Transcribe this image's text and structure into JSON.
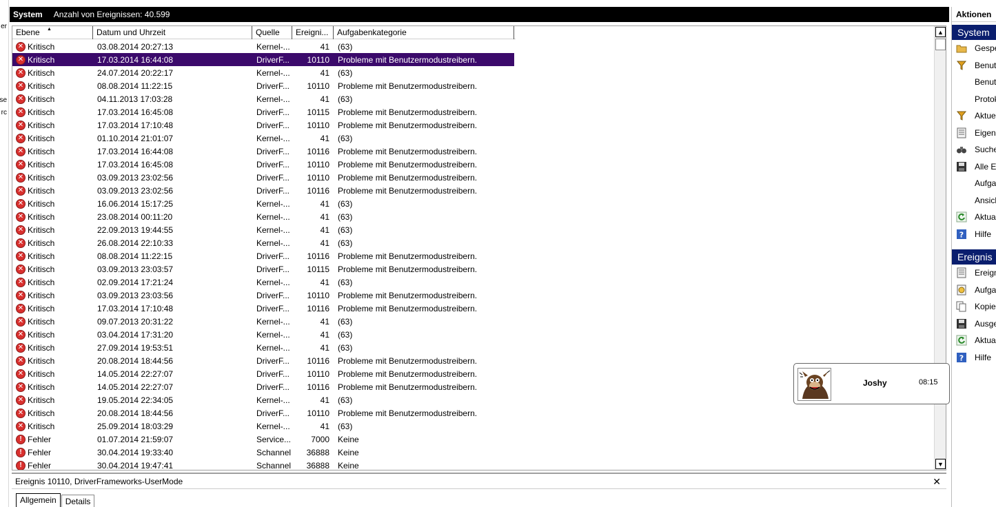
{
  "left_sliver": [
    "er",
    "se",
    "rc"
  ],
  "header": {
    "title": "System",
    "count_text": "Anzahl von Ereignissen: 40.599"
  },
  "columns": [
    "Ebene",
    "Datum und Uhrzeit",
    "Quelle",
    "Ereigni...",
    "Aufgabenkategorie"
  ],
  "rows": [
    {
      "level": "Kritisch",
      "type": "critical",
      "date": "03.08.2014 20:27:13",
      "source": "Kernel-...",
      "id": "41",
      "category": "(63)"
    },
    {
      "level": "Kritisch",
      "type": "critical",
      "date": "17.03.2014 16:44:08",
      "source": "DriverF...",
      "id": "10110",
      "category": "Probleme mit Benutzermodustreibern.",
      "selected": true
    },
    {
      "level": "Kritisch",
      "type": "critical",
      "date": "24.07.2014 20:22:17",
      "source": "Kernel-...",
      "id": "41",
      "category": "(63)"
    },
    {
      "level": "Kritisch",
      "type": "critical",
      "date": "08.08.2014 11:22:15",
      "source": "DriverF...",
      "id": "10110",
      "category": "Probleme mit Benutzermodustreibern."
    },
    {
      "level": "Kritisch",
      "type": "critical",
      "date": "04.11.2013 17:03:28",
      "source": "Kernel-...",
      "id": "41",
      "category": "(63)"
    },
    {
      "level": "Kritisch",
      "type": "critical",
      "date": "17.03.2014 16:45:08",
      "source": "DriverF...",
      "id": "10115",
      "category": "Probleme mit Benutzermodustreibern."
    },
    {
      "level": "Kritisch",
      "type": "critical",
      "date": "17.03.2014 17:10:48",
      "source": "DriverF...",
      "id": "10110",
      "category": "Probleme mit Benutzermodustreibern."
    },
    {
      "level": "Kritisch",
      "type": "critical",
      "date": "01.10.2014 21:01:07",
      "source": "Kernel-...",
      "id": "41",
      "category": "(63)"
    },
    {
      "level": "Kritisch",
      "type": "critical",
      "date": "17.03.2014 16:44:08",
      "source": "DriverF...",
      "id": "10116",
      "category": "Probleme mit Benutzermodustreibern."
    },
    {
      "level": "Kritisch",
      "type": "critical",
      "date": "17.03.2014 16:45:08",
      "source": "DriverF...",
      "id": "10110",
      "category": "Probleme mit Benutzermodustreibern."
    },
    {
      "level": "Kritisch",
      "type": "critical",
      "date": "03.09.2013 23:02:56",
      "source": "DriverF...",
      "id": "10110",
      "category": "Probleme mit Benutzermodustreibern."
    },
    {
      "level": "Kritisch",
      "type": "critical",
      "date": "03.09.2013 23:02:56",
      "source": "DriverF...",
      "id": "10116",
      "category": "Probleme mit Benutzermodustreibern."
    },
    {
      "level": "Kritisch",
      "type": "critical",
      "date": "16.06.2014 15:17:25",
      "source": "Kernel-...",
      "id": "41",
      "category": "(63)"
    },
    {
      "level": "Kritisch",
      "type": "critical",
      "date": "23.08.2014 00:11:20",
      "source": "Kernel-...",
      "id": "41",
      "category": "(63)"
    },
    {
      "level": "Kritisch",
      "type": "critical",
      "date": "22.09.2013 19:44:55",
      "source": "Kernel-...",
      "id": "41",
      "category": "(63)"
    },
    {
      "level": "Kritisch",
      "type": "critical",
      "date": "26.08.2014 22:10:33",
      "source": "Kernel-...",
      "id": "41",
      "category": "(63)"
    },
    {
      "level": "Kritisch",
      "type": "critical",
      "date": "08.08.2014 11:22:15",
      "source": "DriverF...",
      "id": "10116",
      "category": "Probleme mit Benutzermodustreibern."
    },
    {
      "level": "Kritisch",
      "type": "critical",
      "date": "03.09.2013 23:03:57",
      "source": "DriverF...",
      "id": "10115",
      "category": "Probleme mit Benutzermodustreibern."
    },
    {
      "level": "Kritisch",
      "type": "critical",
      "date": "02.09.2014 17:21:24",
      "source": "Kernel-...",
      "id": "41",
      "category": "(63)"
    },
    {
      "level": "Kritisch",
      "type": "critical",
      "date": "03.09.2013 23:03:56",
      "source": "DriverF...",
      "id": "10110",
      "category": "Probleme mit Benutzermodustreibern."
    },
    {
      "level": "Kritisch",
      "type": "critical",
      "date": "17.03.2014 17:10:48",
      "source": "DriverF...",
      "id": "10116",
      "category": "Probleme mit Benutzermodustreibern."
    },
    {
      "level": "Kritisch",
      "type": "critical",
      "date": "09.07.2013 20:31:22",
      "source": "Kernel-...",
      "id": "41",
      "category": "(63)"
    },
    {
      "level": "Kritisch",
      "type": "critical",
      "date": "03.04.2014 17:31:20",
      "source": "Kernel-...",
      "id": "41",
      "category": "(63)"
    },
    {
      "level": "Kritisch",
      "type": "critical",
      "date": "27.09.2014 19:53:51",
      "source": "Kernel-...",
      "id": "41",
      "category": "(63)"
    },
    {
      "level": "Kritisch",
      "type": "critical",
      "date": "20.08.2014 18:44:56",
      "source": "DriverF...",
      "id": "10116",
      "category": "Probleme mit Benutzermodustreibern."
    },
    {
      "level": "Kritisch",
      "type": "critical",
      "date": "14.05.2014 22:27:07",
      "source": "DriverF...",
      "id": "10110",
      "category": "Probleme mit Benutzermodustreibern."
    },
    {
      "level": "Kritisch",
      "type": "critical",
      "date": "14.05.2014 22:27:07",
      "source": "DriverF...",
      "id": "10116",
      "category": "Probleme mit Benutzermodustreibern."
    },
    {
      "level": "Kritisch",
      "type": "critical",
      "date": "19.05.2014 22:34:05",
      "source": "Kernel-...",
      "id": "41",
      "category": "(63)"
    },
    {
      "level": "Kritisch",
      "type": "critical",
      "date": "20.08.2014 18:44:56",
      "source": "DriverF...",
      "id": "10110",
      "category": "Probleme mit Benutzermodustreibern."
    },
    {
      "level": "Kritisch",
      "type": "critical",
      "date": "25.09.2014 18:03:29",
      "source": "Kernel-...",
      "id": "41",
      "category": "(63)"
    },
    {
      "level": "Fehler",
      "type": "error",
      "date": "01.07.2014 21:59:07",
      "source": "Service...",
      "id": "7000",
      "category": "Keine"
    },
    {
      "level": "Fehler",
      "type": "error",
      "date": "30.04.2014 19:33:40",
      "source": "Schannel",
      "id": "36888",
      "category": "Keine"
    },
    {
      "level": "Fehler",
      "type": "error",
      "date": "30.04.2014 19:47:41",
      "source": "Schannel",
      "id": "36888",
      "category": "Keine"
    }
  ],
  "details": {
    "title": "Ereignis 10110, DriverFrameworks-UserMode",
    "close": "✕",
    "tabs": [
      "Allgemein",
      "Details"
    ]
  },
  "actions": {
    "title": "Aktionen",
    "sections": [
      {
        "header": "System",
        "items": [
          {
            "label": "Gespe",
            "icon": "folder-icon"
          },
          {
            "label": "Benut",
            "icon": "filter-icon"
          },
          {
            "label": "Benut",
            "icon": ""
          },
          {
            "label": "Protok",
            "icon": ""
          },
          {
            "label": "Aktue",
            "icon": "filter-icon"
          },
          {
            "label": "Eigens",
            "icon": "properties-icon"
          },
          {
            "label": "Suche",
            "icon": "binoculars-icon"
          },
          {
            "label": "Alle Er",
            "icon": "save-icon"
          },
          {
            "label": "Aufga",
            "icon": ""
          },
          {
            "label": "Ansich",
            "icon": ""
          },
          {
            "label": "Aktua",
            "icon": "refresh-icon"
          },
          {
            "label": "Hilfe",
            "icon": "help-icon"
          }
        ]
      },
      {
        "header": "Ereignis",
        "items": [
          {
            "label": "Ereign",
            "icon": "properties-icon"
          },
          {
            "label": "Aufga",
            "icon": "task-icon"
          },
          {
            "label": "Kopier",
            "icon": "copy-icon"
          },
          {
            "label": "Ausge",
            "icon": "save-icon"
          },
          {
            "label": "Aktua",
            "icon": "refresh-icon"
          },
          {
            "label": "Hilfe",
            "icon": "help-icon"
          }
        ]
      }
    ]
  },
  "notification": {
    "name": "Joshy",
    "time": "08:15"
  },
  "colors": {
    "selected_row": "#3b0a6b",
    "section_header": "#0a1e6e",
    "critical_icon": "#d9302e"
  }
}
